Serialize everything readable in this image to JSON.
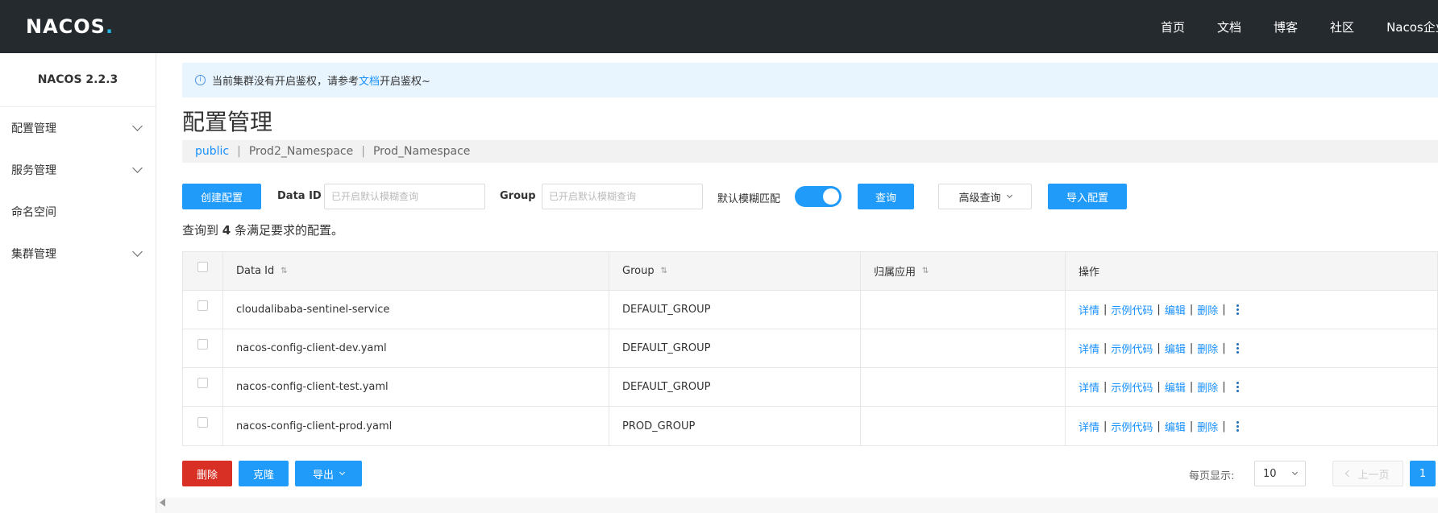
{
  "header": {
    "logo_text": "NACOS",
    "logo_dot": ".",
    "nav": [
      "首页",
      "文档",
      "博客",
      "社区",
      "Nacos企业版"
    ]
  },
  "sidebar": {
    "version": "NACOS 2.2.3",
    "items": [
      {
        "label": "配置管理",
        "expandable": true
      },
      {
        "label": "服务管理",
        "expandable": true
      },
      {
        "label": "命名空间",
        "expandable": false
      },
      {
        "label": "集群管理",
        "expandable": true
      }
    ]
  },
  "notice": {
    "prefix": "当前集群没有开启鉴权，请参考",
    "link": "文档",
    "suffix": "开启鉴权~"
  },
  "page": {
    "title": "配置管理"
  },
  "namespaces": [
    "public",
    "Prod2_Namespace",
    "Prod_Namespace"
  ],
  "toolbar": {
    "create_label": "创建配置",
    "dataid_label": "Data ID",
    "dataid_placeholder": "已开启默认模糊查询",
    "group_label": "Group",
    "group_placeholder": "已开启默认模糊查询",
    "fuzzy_label": "默认模糊匹配",
    "query_label": "查询",
    "advanced_label": "高级查询",
    "import_label": "导入配置"
  },
  "summary": {
    "prefix": "查询到 ",
    "count": "4",
    "suffix": " 条满足要求的配置。"
  },
  "table": {
    "headers": [
      "Data Id",
      "Group",
      "归属应用",
      "操作"
    ],
    "rows": [
      {
        "data_id": "cloudalibaba-sentinel-service",
        "group": "DEFAULT_GROUP",
        "app": ""
      },
      {
        "data_id": "nacos-config-client-dev.yaml",
        "group": "DEFAULT_GROUP",
        "app": ""
      },
      {
        "data_id": "nacos-config-client-test.yaml",
        "group": "DEFAULT_GROUP",
        "app": ""
      },
      {
        "data_id": "nacos-config-client-prod.yaml",
        "group": "PROD_GROUP",
        "app": ""
      }
    ],
    "ops": [
      "详情",
      "示例代码",
      "编辑",
      "删除"
    ]
  },
  "footer": {
    "delete_label": "删除",
    "clone_label": "克隆",
    "export_label": "导出",
    "page_size_label": "每页显示:",
    "page_size": "10",
    "prev_label": "上一页",
    "current_page": "1"
  },
  "colors": {
    "primary": "#209bfa",
    "danger": "#d93025",
    "header_bg": "#252a2f",
    "link": "#1890ff"
  }
}
